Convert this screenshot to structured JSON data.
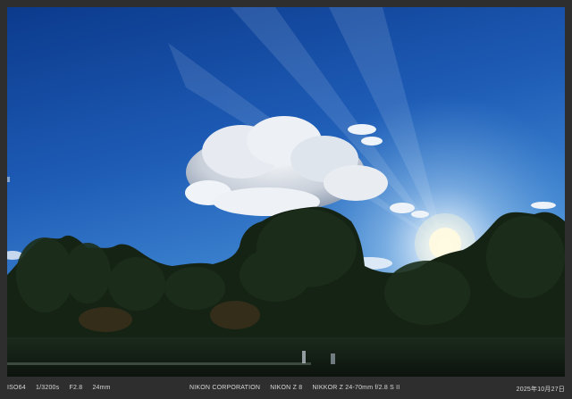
{
  "photo": {
    "subject": "blue-sky-with-cloud-trees-and-sun-icon",
    "colors": {
      "sky_top": "#0d3f93",
      "sky_mid": "#2f73c8",
      "sky_light": "#9cc4ea",
      "cloud": "#e9edf3",
      "foliage": "#162216",
      "sun": "#fffbe8"
    }
  },
  "caption": {
    "iso": "ISO64",
    "shutter": "1/3200s",
    "aperture": "F2.8",
    "focal": "24mm",
    "brand": "NIKON CORPORATION",
    "model": "NIKON Z 8",
    "lens": "NIKKOR Z 24-70mm f/2.8 S II",
    "date": "2025年10月27日"
  }
}
